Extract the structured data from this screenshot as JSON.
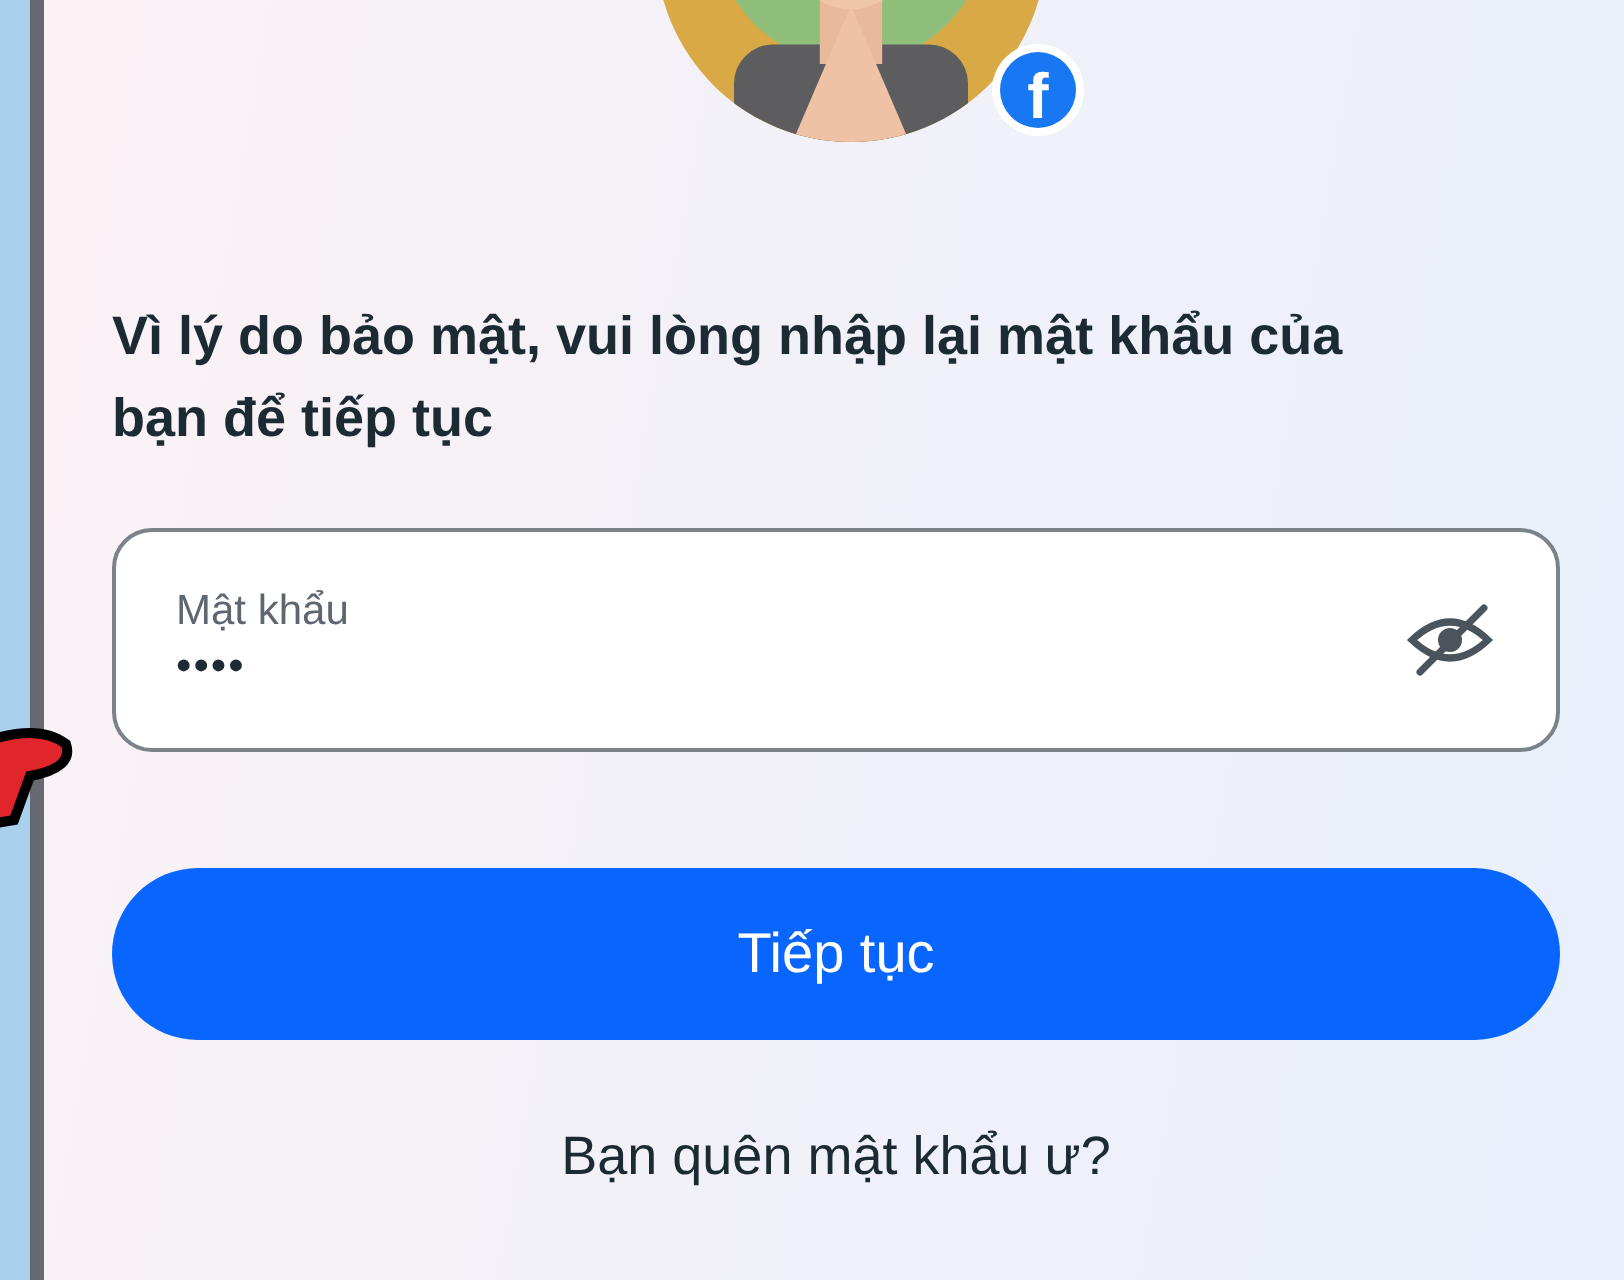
{
  "profile": {
    "kind": "picture",
    "badge": "f"
  },
  "prompt": "Vì lý do bảo mật, vui lòng nhập lại mật khẩu của bạn để tiếp tục",
  "password_field": {
    "label": "Mật khẩu",
    "value": "••••",
    "reveal": false
  },
  "continue_button": "Tiếp tục",
  "forgot_link": "Bạn quên mật khẩu ư?"
}
